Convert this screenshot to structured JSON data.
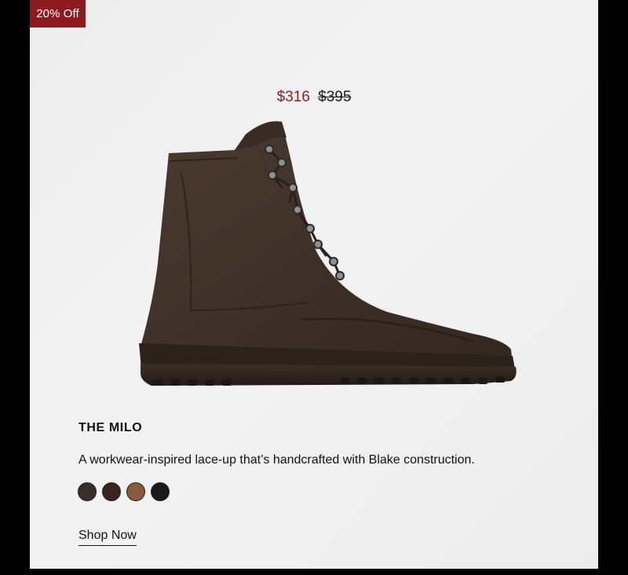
{
  "badge": {
    "label": "20% Off"
  },
  "price": {
    "sale": "$316",
    "original": "$395"
  },
  "product": {
    "name": "THE MILO",
    "description": "A workwear-inspired lace-up that’s handcrafted with Blake construction."
  },
  "swatches": [
    {
      "color": "#3a2e2a"
    },
    {
      "color": "#3b2320"
    },
    {
      "color": "#8a5a3c"
    },
    {
      "color": "#1a1a1a"
    }
  ],
  "cta": {
    "label": "Shop Now"
  },
  "colors": {
    "accent": "#8d1a1f",
    "boot": "#3f3129"
  }
}
